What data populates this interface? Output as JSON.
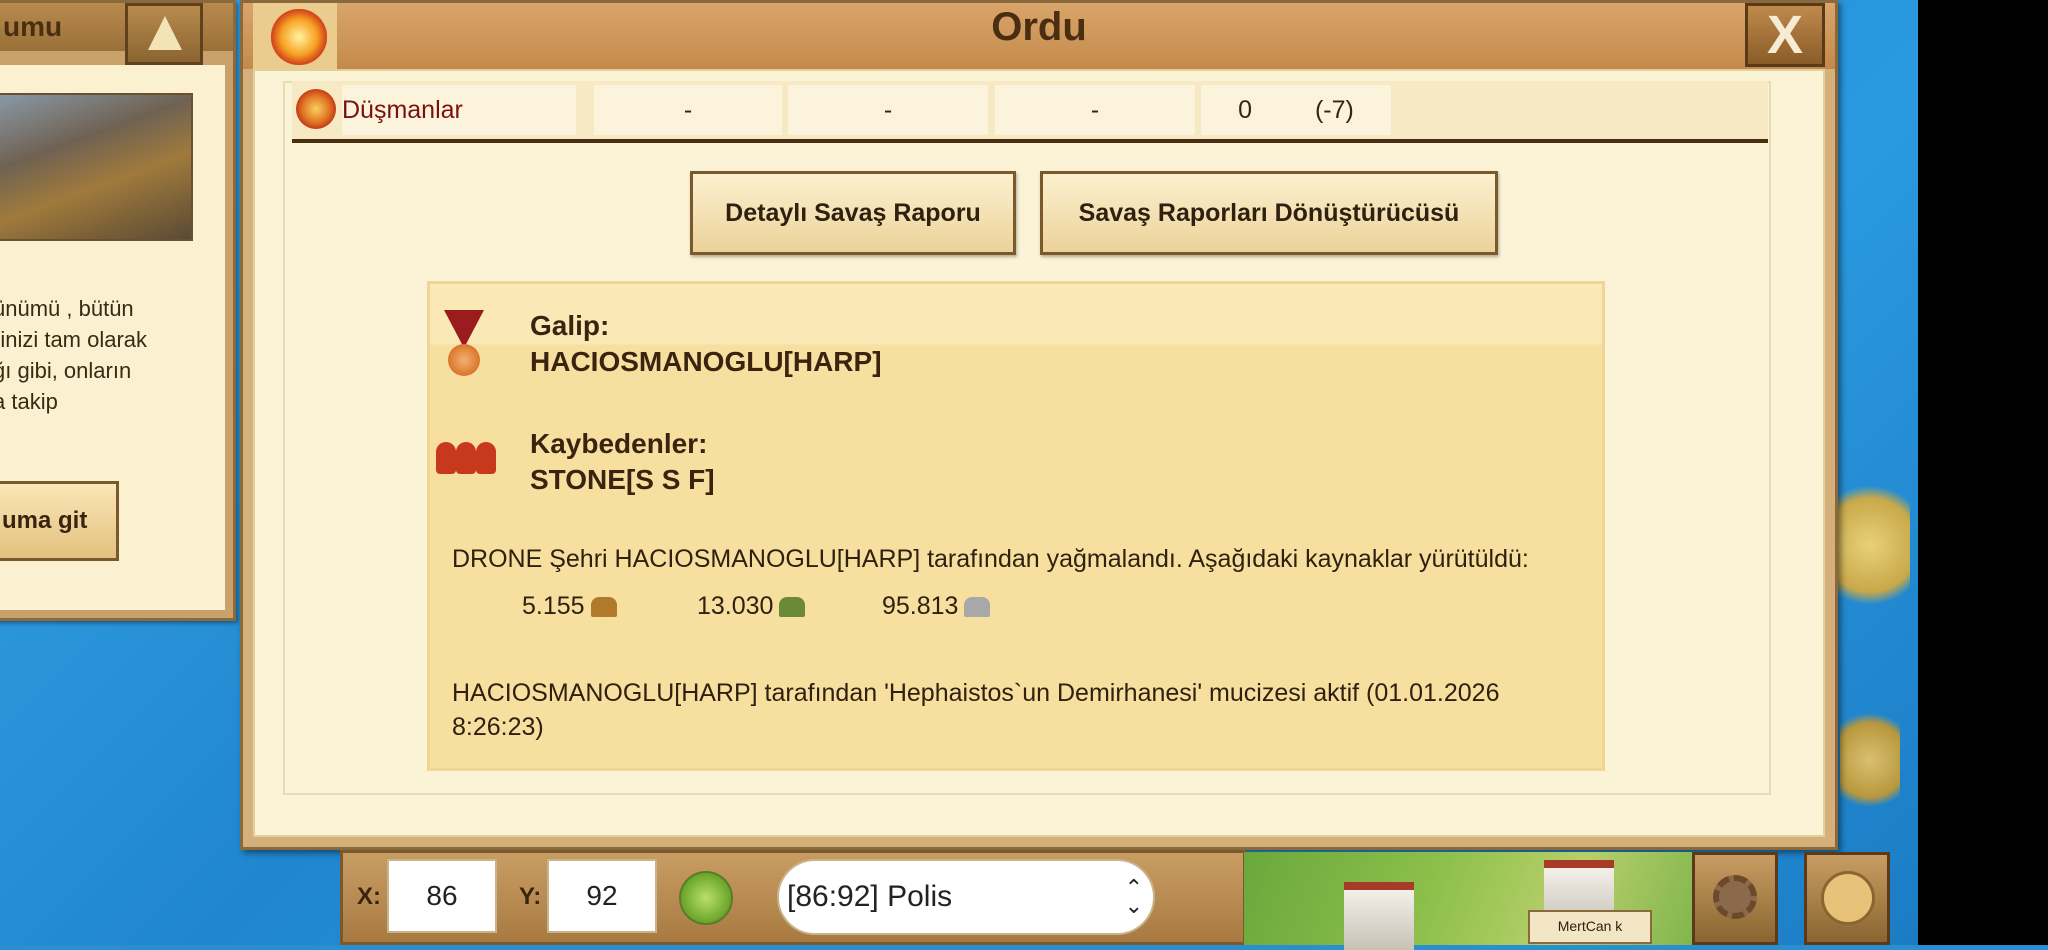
{
  "window": {
    "title": "Ordu",
    "close_label": "X"
  },
  "enemies_row": {
    "label": "Düşmanlar",
    "cells": [
      "-",
      "-",
      "-",
      "0",
      "(-7)"
    ]
  },
  "buttons": {
    "detailed_report": "Detaylı Savaş Raporu",
    "report_converter": "Savaş Raporları Dönüştürücüsü"
  },
  "result": {
    "winner_heading": "Galip:",
    "winner_name": "HACIOSMANOGLU[HARP]",
    "losers_heading": "Kaybedenler:",
    "losers_name": "STONE[S S F]",
    "plunder_text": "DRONE Şehri HACIOSMANOGLU[HARP] tarafından yağmalandı. Aşağıdaki kaynaklar yürütüldü:",
    "resources": [
      {
        "amount": "5.155",
        "icon": "wood-icon",
        "color": "#b07a2a"
      },
      {
        "amount": "13.030",
        "icon": "stone-icon",
        "color": "#6a8a3a"
      },
      {
        "amount": "95.813",
        "icon": "silver-icon",
        "color": "#a8a8a8"
      }
    ],
    "miracle_text": "HACIOSMANOGLU[HARP] tarafından 'Hephaistos`un Demirhanesi' mucizesi aktif (01.01.2026 8:26:23)"
  },
  "left_panel": {
    "title": "umu",
    "text": "ünümü , bütün\nrinizi tam olarak\nğı gibi, onların\na takip",
    "button_label": "uma git"
  },
  "bottom_bar": {
    "x_label": "X:",
    "x_value": "86",
    "y_label": "Y:",
    "y_value": "92",
    "city_select": "[86:92] Polis"
  },
  "minimap": {
    "player_tag": "MertCan k"
  }
}
